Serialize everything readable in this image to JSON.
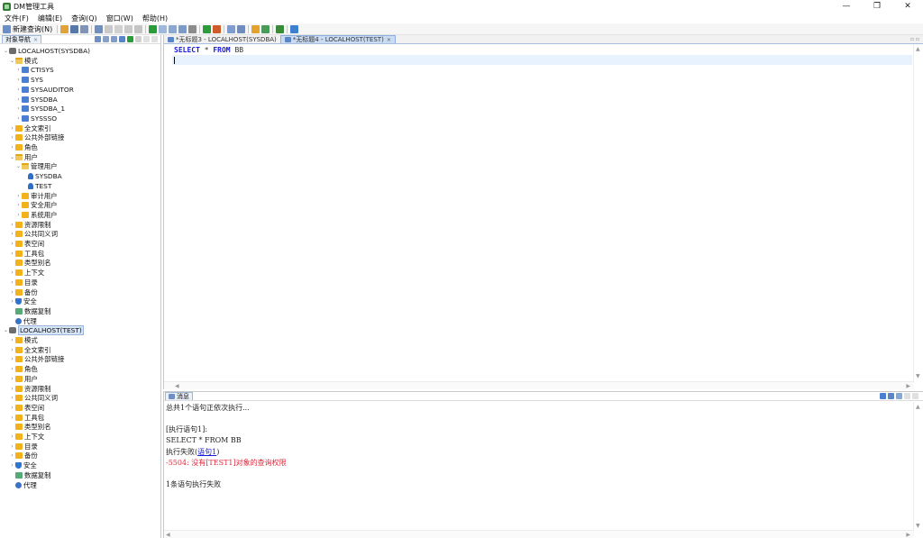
{
  "window": {
    "title": "DM管理工具",
    "minimize": "—",
    "restore": "❐",
    "close": "✕"
  },
  "menu": [
    "文件(F)",
    "编辑(E)",
    "查询(Q)",
    "窗口(W)",
    "帮助(H)"
  ],
  "toolbar": {
    "new_query_label": "新建查询(N)"
  },
  "object_nav": {
    "tab_label": "对象导航",
    "tab_close": "✕",
    "tree": [
      {
        "level": 0,
        "arrow": "⌄",
        "icon": "db",
        "label": "LOCALHOST(SYSDBA)"
      },
      {
        "level": 1,
        "arrow": "⌄",
        "icon": "folder-open",
        "label": "模式"
      },
      {
        "level": 2,
        "arrow": "›",
        "icon": "schema",
        "label": "CTISYS"
      },
      {
        "level": 2,
        "arrow": "›",
        "icon": "schema",
        "label": "SYS"
      },
      {
        "level": 2,
        "arrow": "›",
        "icon": "schema",
        "label": "SYSAUDITOR"
      },
      {
        "level": 2,
        "arrow": "›",
        "icon": "schema",
        "label": "SYSDBA"
      },
      {
        "level": 2,
        "arrow": "›",
        "icon": "schema",
        "label": "SYSDBA_1"
      },
      {
        "level": 2,
        "arrow": "›",
        "icon": "schema",
        "label": "SYSSSO"
      },
      {
        "level": 1,
        "arrow": "›",
        "icon": "folder",
        "label": "全文索引"
      },
      {
        "level": 1,
        "arrow": "›",
        "icon": "folder",
        "label": "公共外部链接"
      },
      {
        "level": 1,
        "arrow": "›",
        "icon": "folder",
        "label": "角色"
      },
      {
        "level": 1,
        "arrow": "⌄",
        "icon": "folder-open",
        "label": "用户"
      },
      {
        "level": 2,
        "arrow": "⌄",
        "icon": "folder-open",
        "label": "管理用户"
      },
      {
        "level": 3,
        "arrow": "",
        "icon": "user",
        "label": "SYSDBA"
      },
      {
        "level": 3,
        "arrow": "",
        "icon": "user",
        "label": "TEST"
      },
      {
        "level": 2,
        "arrow": "›",
        "icon": "folder",
        "label": "审计用户"
      },
      {
        "level": 2,
        "arrow": "›",
        "icon": "folder",
        "label": "安全用户"
      },
      {
        "level": 2,
        "arrow": "›",
        "icon": "folder",
        "label": "系统用户"
      },
      {
        "level": 1,
        "arrow": "›",
        "icon": "folder",
        "label": "资源限制"
      },
      {
        "level": 1,
        "arrow": "›",
        "icon": "folder",
        "label": "公共同义词"
      },
      {
        "level": 1,
        "arrow": "›",
        "icon": "folder",
        "label": "表空间"
      },
      {
        "level": 1,
        "arrow": "›",
        "icon": "folder",
        "label": "工具包"
      },
      {
        "level": 1,
        "arrow": "",
        "icon": "folder",
        "label": "类型别名"
      },
      {
        "level": 1,
        "arrow": "›",
        "icon": "folder",
        "label": "上下文"
      },
      {
        "level": 1,
        "arrow": "›",
        "icon": "folder",
        "label": "目录"
      },
      {
        "level": 1,
        "arrow": "›",
        "icon": "folder",
        "label": "备份"
      },
      {
        "level": 1,
        "arrow": "›",
        "icon": "shield",
        "label": "安全"
      },
      {
        "level": 1,
        "arrow": "",
        "icon": "repl",
        "label": "数据复制"
      },
      {
        "level": 1,
        "arrow": "",
        "icon": "agent",
        "label": "代理"
      },
      {
        "level": 0,
        "arrow": "⌄",
        "icon": "db",
        "label": "LOCALHOST(TEST)",
        "selected": true
      },
      {
        "level": 1,
        "arrow": "›",
        "icon": "folder",
        "label": "模式"
      },
      {
        "level": 1,
        "arrow": "›",
        "icon": "folder",
        "label": "全文索引"
      },
      {
        "level": 1,
        "arrow": "›",
        "icon": "folder",
        "label": "公共外部链接"
      },
      {
        "level": 1,
        "arrow": "›",
        "icon": "folder",
        "label": "角色"
      },
      {
        "level": 1,
        "arrow": "›",
        "icon": "folder",
        "label": "用户"
      },
      {
        "level": 1,
        "arrow": "›",
        "icon": "folder",
        "label": "资源限制"
      },
      {
        "level": 1,
        "arrow": "›",
        "icon": "folder",
        "label": "公共同义词"
      },
      {
        "level": 1,
        "arrow": "›",
        "icon": "folder",
        "label": "表空间"
      },
      {
        "level": 1,
        "arrow": "›",
        "icon": "folder",
        "label": "工具包"
      },
      {
        "level": 1,
        "arrow": "",
        "icon": "folder",
        "label": "类型别名"
      },
      {
        "level": 1,
        "arrow": "›",
        "icon": "folder",
        "label": "上下文"
      },
      {
        "level": 1,
        "arrow": "›",
        "icon": "folder",
        "label": "目录"
      },
      {
        "level": 1,
        "arrow": "›",
        "icon": "folder",
        "label": "备份"
      },
      {
        "level": 1,
        "arrow": "›",
        "icon": "shield",
        "label": "安全"
      },
      {
        "level": 1,
        "arrow": "",
        "icon": "repl",
        "label": "数据复制"
      },
      {
        "level": 1,
        "arrow": "",
        "icon": "agent",
        "label": "代理"
      }
    ]
  },
  "editor": {
    "tabs": [
      {
        "label": "*无标题3 - LOCALHOST(SYSDBA)",
        "active": false
      },
      {
        "label": "*无标题4 - LOCALHOST(TEST)",
        "active": true
      }
    ],
    "tab_close": "✕",
    "sql_keyword_1": "SELECT",
    "sql_star": " * ",
    "sql_keyword_2": "FROM",
    "sql_table": " BB"
  },
  "messages": {
    "tab_label": "消息",
    "lines": [
      {
        "text": "总共1个语句正依次执行...",
        "kind": "normal"
      },
      {
        "text": "",
        "kind": "blank"
      },
      {
        "text": "[执行语句1]:",
        "kind": "normal"
      },
      {
        "text": "SELECT * FROM BB",
        "kind": "normal"
      },
      {
        "text": "执行失败(",
        "link": "语句1",
        "suffix": ")",
        "kind": "link"
      },
      {
        "text": "-5504: 没有[TEST1]对象的查询权限",
        "kind": "err"
      },
      {
        "text": "",
        "kind": "blank"
      },
      {
        "text": "1条语句执行失败",
        "kind": "normal"
      }
    ]
  },
  "colors": {
    "keyword": "#1a1ad8",
    "error": "#e0283c",
    "selection": "#d6e4f5",
    "current_line": "#e8f2fe"
  }
}
